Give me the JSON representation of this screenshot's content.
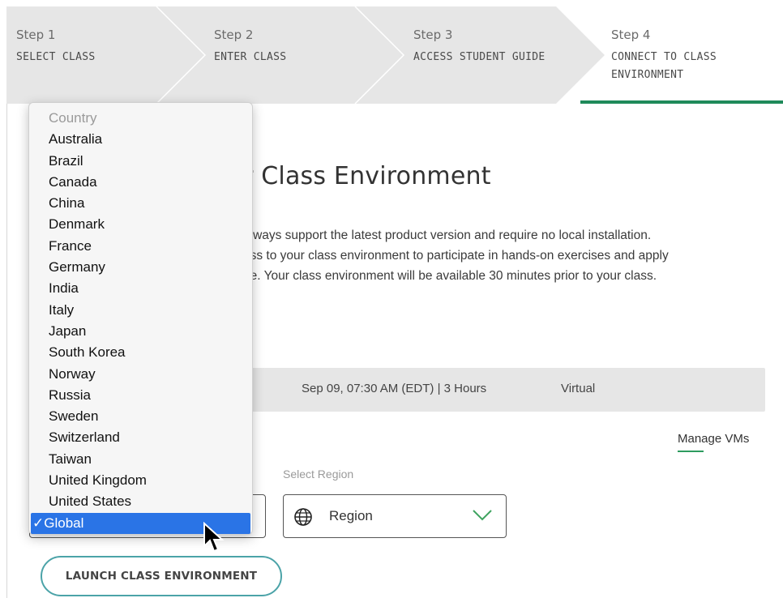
{
  "stepper": {
    "steps": [
      {
        "number": "Step 1",
        "title": "SELECT CLASS"
      },
      {
        "number": "Step 2",
        "title": "ENTER CLASS"
      },
      {
        "number": "Step 3",
        "title": "ACCESS STUDENT GUIDE"
      },
      {
        "number": "Step 4",
        "title_line1": "CONNECT TO CLASS",
        "title_line2": "ENVIRONMENT"
      }
    ],
    "active_step": 4,
    "accent_color": "#1f8a5a"
  },
  "main": {
    "heading_visible": "r Class Environment",
    "description_lines": [
      "always support the latest product version and require no local installation.",
      "ess to your class environment to participate in hands-on exercises and apply",
      "ne. Your class environment will be available 30 minutes prior to your class."
    ],
    "session": {
      "datetime": "Sep 09, 07:30 AM (EDT) | 3 Hours",
      "mode": "Virtual"
    },
    "manage_vms": "Manage VMs",
    "region": {
      "label": "Select Region",
      "value": "Region"
    },
    "launch_button": "LAUNCH CLASS ENVIRONMENT"
  },
  "country_dropdown": {
    "placeholder": "Country",
    "options": [
      "Australia",
      "Brazil",
      "Canada",
      "China",
      "Denmark",
      "France",
      "Germany",
      "India",
      "Italy",
      "Japan",
      "South Korea",
      "Norway",
      "Russia",
      "Sweden",
      "Switzerland",
      "Taiwan",
      "United Kingdom",
      "United States"
    ],
    "selected_mark": "✓",
    "selected": "Global",
    "highlight_color": "#2a74e6"
  }
}
